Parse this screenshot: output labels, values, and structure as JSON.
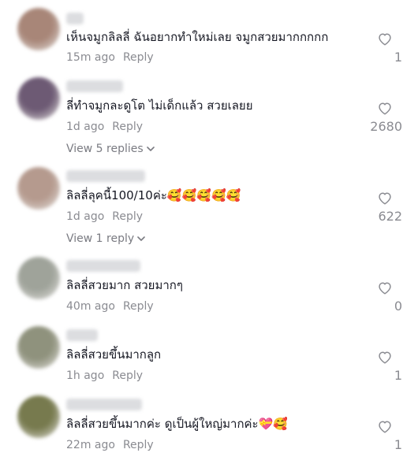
{
  "comments": [
    {
      "text": "เห็นจมูกลิลลี่ ฉันอยากทำใหม่เลย จมูกสวยมากกกกก",
      "time": "15m ago",
      "reply": "Reply",
      "likes": "1",
      "avatar_color": "#a88678"
    },
    {
      "text": "ลี่ทำจมูกละดูโต ไม่เด็กแล้ว สวยเลยย",
      "time": "1d ago",
      "reply": "Reply",
      "likes": "2680",
      "view_replies": "View 5 replies",
      "avatar_color": "#6d5a74"
    },
    {
      "text": "ลิลลี่ลุคนี้100/10ค่ะ🥰🥰🥰🥰🥰",
      "time": "1d ago",
      "reply": "Reply",
      "likes": "622",
      "view_replies": "View 1 reply",
      "avatar_color": "#b59a8e"
    },
    {
      "text": "ลิลลี่สวยมาก สวยมากๆ",
      "time": "40m ago",
      "reply": "Reply",
      "likes": "0",
      "avatar_color": "#9fa39a"
    },
    {
      "text": "ลิลลี่สวยขึ้นมากลูก",
      "time": "1h ago",
      "reply": "Reply",
      "likes": "1",
      "avatar_color": "#8f927d"
    },
    {
      "text": "ลิลลี่สวยขึ้นมากค่ะ ดูเป็นผู้ใหญ่มากค่ะ💝🥰",
      "time": "22m ago",
      "reply": "Reply",
      "likes": "1",
      "avatar_color": "#777a4e"
    }
  ]
}
